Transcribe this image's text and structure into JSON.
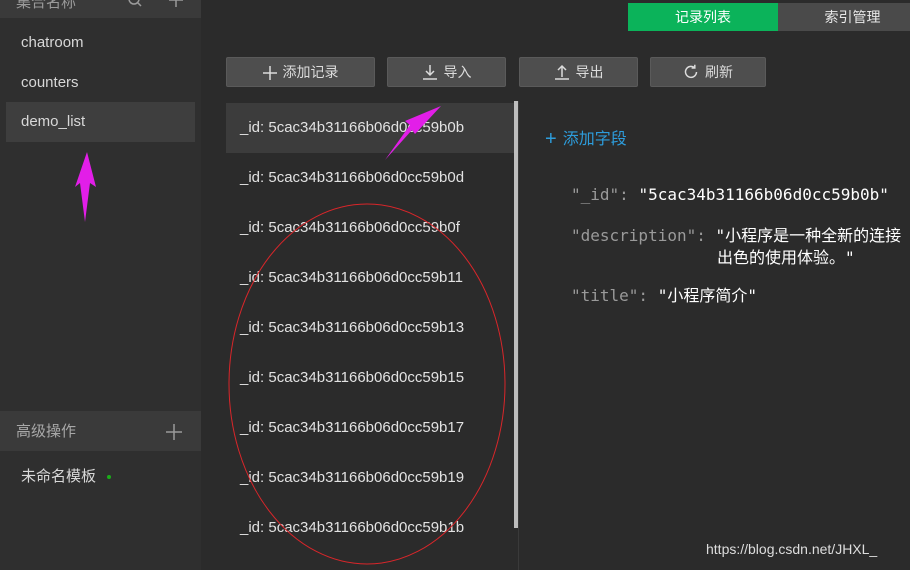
{
  "sidebar": {
    "header_title": "集合名称",
    "collections": [
      "chatroom",
      "counters",
      "demo_list"
    ],
    "active_collection": "demo_list",
    "advanced_label": "高级操作",
    "template_label": "未命名模板"
  },
  "tabs": {
    "records": "记录列表",
    "indexes": "索引管理"
  },
  "toolbar": {
    "add_record": "添加记录",
    "import": "导入",
    "export": "导出",
    "refresh": "刷新"
  },
  "records": [
    "_id: 5cac34b31166b06d0cc59b0b",
    "_id: 5cac34b31166b06d0cc59b0d",
    "_id: 5cac34b31166b06d0cc59b0f",
    "_id: 5cac34b31166b06d0cc59b11",
    "_id: 5cac34b31166b06d0cc59b13",
    "_id: 5cac34b31166b06d0cc59b15",
    "_id: 5cac34b31166b06d0cc59b17",
    "_id: 5cac34b31166b06d0cc59b19",
    "_id: 5cac34b31166b06d0cc59b1b"
  ],
  "detail": {
    "add_field": "添加字段",
    "fields": {
      "id_key": "\"_id\":",
      "id_value": "\"5cac34b31166b06d0cc59b0b\"",
      "description_key": "\"description\":",
      "description_value_line1": "\"小程序是一种全新的连接",
      "description_value_line2": "出色的使用体验。\"",
      "title_key": "\"title\":",
      "title_value": "\"小程序简介\""
    }
  },
  "watermark": "https://blog.csdn.net/JHXL_",
  "colors": {
    "accent_green": "#0bb35a",
    "link_blue": "#2d9cdb",
    "annotation_magenta": "#e21ee8",
    "annotation_red": "#d9262a"
  }
}
